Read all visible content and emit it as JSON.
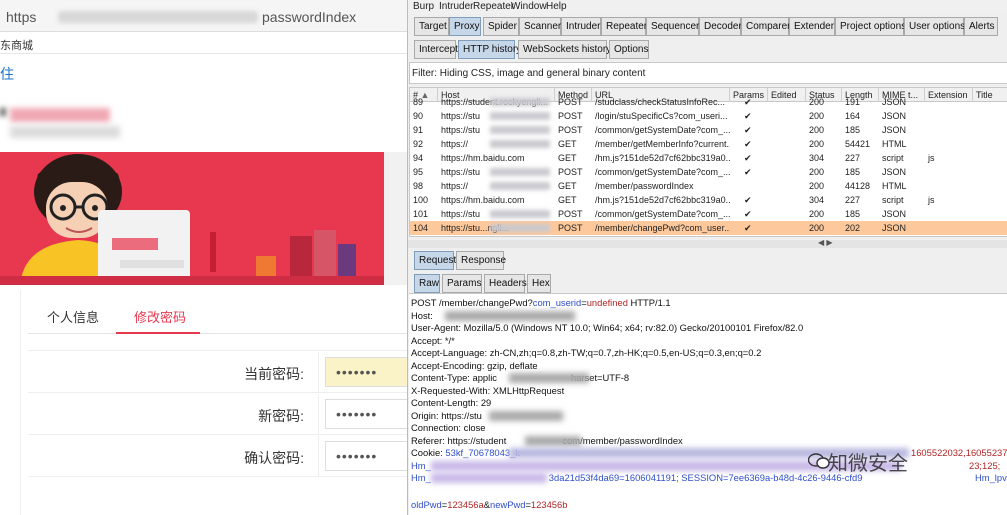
{
  "browser": {
    "url_prefix": "https",
    "url_suffix": "passwordIndex",
    "bookmark": "东商城",
    "top_link": "住"
  },
  "page": {
    "tabs": [
      "个人信息",
      "修改密码"
    ],
    "active_tab": 1,
    "fields": [
      {
        "label": "当前密码:",
        "value": "•••••••"
      },
      {
        "label": "新密码:",
        "value": "•••••••"
      },
      {
        "label": "确认密码:",
        "value": "•••••••"
      }
    ]
  },
  "burp": {
    "menu": [
      "Burp",
      "Intruder",
      "Repeater",
      "Window",
      "Help"
    ],
    "main_tabs": [
      "Target",
      "Proxy",
      "Spider",
      "Scanner",
      "Intruder",
      "Repeater",
      "Sequencer",
      "Decoder",
      "Comparer",
      "Extender",
      "Project options",
      "User options",
      "Alerts"
    ],
    "main_active": "Proxy",
    "sub_tabs": [
      "Intercept",
      "HTTP history",
      "WebSockets history",
      "Options"
    ],
    "sub_active": "HTTP history",
    "filter": "Filter: Hiding CSS, image and general binary content",
    "columns": [
      "#",
      "Host",
      "Method",
      "URL",
      "Params",
      "Edited",
      "Status",
      "Length",
      "MIME t...",
      "Extension",
      "Title"
    ],
    "sort_icon": "sort-ascending-icon",
    "rows": [
      {
        "id": "89",
        "host": "https://student.rockyengli...",
        "method": "POST",
        "url": "/studclass/checkStatusInfoRec...",
        "params": "✔",
        "status": "200",
        "length": "191",
        "mime": "JSON",
        "ext": "",
        "host_blurred": true
      },
      {
        "id": "90",
        "host": "https://stu",
        "method": "POST",
        "url": "/login/stuSpecificCs?com_useri...",
        "params": "✔",
        "status": "200",
        "length": "164",
        "mime": "JSON",
        "ext": "",
        "host_blurred": true
      },
      {
        "id": "91",
        "host": "https://stu",
        "method": "POST",
        "url": "/common/getSystemDate?com_...",
        "params": "✔",
        "status": "200",
        "length": "185",
        "mime": "JSON",
        "ext": "",
        "host_blurred": true
      },
      {
        "id": "92",
        "host": "https://",
        "method": "GET",
        "url": "/member/getMemberInfo?current...",
        "params": "✔",
        "status": "200",
        "length": "54421",
        "mime": "HTML",
        "ext": "",
        "host_blurred": true
      },
      {
        "id": "94",
        "host": "https://hm.baidu.com",
        "method": "GET",
        "url": "/hm.js?151de52d7cf62bbc319a0...",
        "params": "✔",
        "status": "304",
        "length": "227",
        "mime": "script",
        "ext": "js",
        "host_blurred": false
      },
      {
        "id": "95",
        "host": "https://stu",
        "method": "POST",
        "url": "/common/getSystemDate?com_...",
        "params": "✔",
        "status": "200",
        "length": "185",
        "mime": "JSON",
        "ext": "",
        "host_blurred": true
      },
      {
        "id": "98",
        "host": "https://",
        "method": "GET",
        "url": "/member/passwordIndex",
        "params": "",
        "status": "200",
        "length": "44128",
        "mime": "HTML",
        "ext": "",
        "host_blurred": true
      },
      {
        "id": "100",
        "host": "https://hm.baidu.com",
        "method": "GET",
        "url": "/hm.js?151de52d7cf62bbc319a0...",
        "params": "✔",
        "status": "304",
        "length": "227",
        "mime": "script",
        "ext": "js",
        "host_blurred": false
      },
      {
        "id": "101",
        "host": "https://stu",
        "method": "POST",
        "url": "/common/getSystemDate?com_...",
        "params": "✔",
        "status": "200",
        "length": "185",
        "mime": "JSON",
        "ext": "",
        "host_blurred": true
      },
      {
        "id": "104",
        "host": "https://stu...ngli...",
        "method": "POST",
        "url": "/member/changePwd?com_user...",
        "params": "✔",
        "status": "200",
        "length": "202",
        "mime": "JSON",
        "ext": "",
        "host_blurred": true,
        "selected": true
      }
    ],
    "reqres_tabs": [
      "Request",
      "Response"
    ],
    "view_tabs": [
      "Raw",
      "Params",
      "Headers",
      "Hex"
    ],
    "request": {
      "l1_pre": "POST /member/changePwd?",
      "l1_param": "com_userid",
      "l1_eq": "=",
      "l1_val": "undefined",
      "l1_post": " HTTP/1.1",
      "host": "Host: ",
      "ua": "User-Agent: Mozilla/5.0 (Windows NT 10.0; Win64; x64; rv:82.0) Gecko/20100101 Firefox/82.0",
      "accept": "Accept: */*",
      "lang": "Accept-Language: zh-CN,zh;q=0.8,zh-TW;q=0.7,zh-HK;q=0.5,en-US;q=0.3,en;q=0.2",
      "enc": "Accept-Encoding: gzip, deflate",
      "ctype_pre": "Content-Type: applic",
      "ctype_post": "harset=UTF-8",
      "xrw": "X-Requested-With: XMLHttpRequest",
      "clen": "Content-Length: 29",
      "origin": "Origin: https://stu",
      "conn": "Connection: close",
      "referer_pre": "Referer: https://student",
      "referer_post": "com/member/passwordIndex",
      "cookie_label": "Cookie: ",
      "cookie_val": "53kf_70678043_k",
      "cookie_right": "1605522032,1605523728",
      "hm_pre": "Hm_",
      "hm_right": "23;125;",
      "hm2_pre": "Hm_",
      "hm2_mid": "3da21d53f4da69=1606041191; SESSION=7ee6369a-b48d-4c26-9446-cfd9",
      "hm2_right": "Hm_lpvt_",
      "body_p1": "oldPwd",
      "body_v1": "123456a",
      "body_p2": "newPwd",
      "body_v2": "123456b"
    },
    "watermark": "知微安全"
  }
}
